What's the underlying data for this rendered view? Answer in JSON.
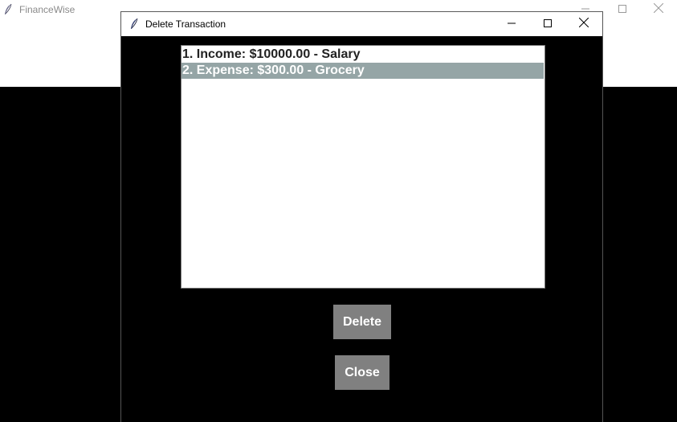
{
  "main_window": {
    "title": "FinanceWise",
    "icon": "feather-icon",
    "controls": [
      "minimize-icon",
      "maximize-icon",
      "close-icon"
    ]
  },
  "dialog": {
    "title": "Delete Transaction",
    "icon": "feather-icon",
    "controls": [
      "minimize-icon",
      "maximize-icon",
      "close-icon"
    ],
    "transactions": [
      {
        "label": "1. Income: $10000.00 - Salary",
        "selected": false
      },
      {
        "label": "2. Expense: $300.00 - Grocery",
        "selected": true
      }
    ],
    "delete_label": "Delete",
    "close_label": "Close"
  },
  "colors": {
    "selection": "#95a5a6",
    "button": "#808080",
    "background": "#000000"
  }
}
